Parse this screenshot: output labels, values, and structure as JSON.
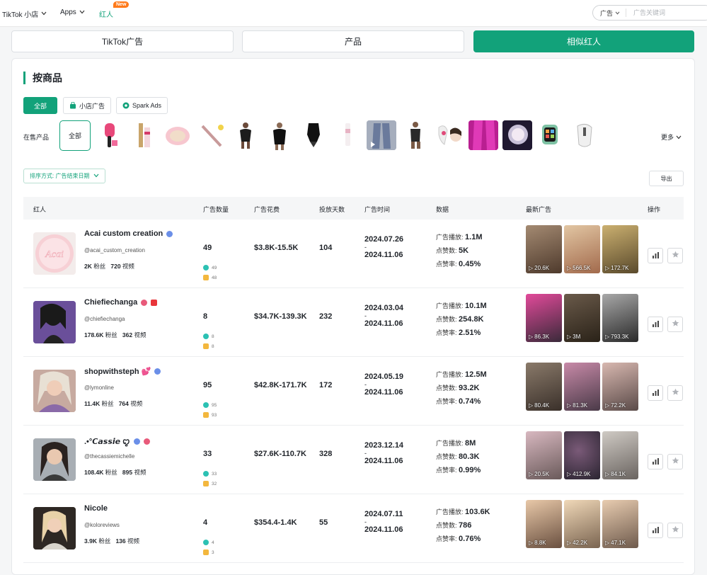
{
  "nav": {
    "items": [
      {
        "label": "TikTok 小店"
      },
      {
        "label": "Apps"
      },
      {
        "label": "红人"
      }
    ],
    "new_badge": "New",
    "search_select": "广告",
    "search_placeholder": "广告关键词"
  },
  "tabs": [
    {
      "label": "TikTok广告"
    },
    {
      "label": "产品"
    },
    {
      "label": "相似红人"
    }
  ],
  "section": {
    "title": "按商品",
    "filters": [
      {
        "label": "全部"
      },
      {
        "label": "小店广告"
      },
      {
        "label": "Spark Ads"
      }
    ],
    "products_label": "在售产品",
    "products_all": "全部",
    "more": "更多",
    "sort_label": "排序方式: 广告结束日期",
    "export": "导出"
  },
  "table": {
    "headers": [
      "红人",
      "广告数量",
      "广告花费",
      "投放天数",
      "广告时间",
      "数据",
      "最新广告",
      "操作"
    ],
    "metric_labels": [
      "广告播放:",
      "点赞数:",
      "点赞率:"
    ],
    "followers_suffix": "粉丝",
    "videos_suffix": "视频",
    "rows": [
      {
        "name": "Acai custom creation",
        "handle": "@acai_custom_creation",
        "followers": "2K",
        "videos": "720",
        "ad_count": "49",
        "sub1": "49",
        "sub2": "48",
        "spend": "$3.8K-15.5K",
        "days": "104",
        "start": "2024.07.26",
        "end": "2024.11.06",
        "plays": "1.1M",
        "likes": "5K",
        "like_rate": "0.45%",
        "videos_views": [
          "20.6K",
          "566.5K",
          "172.7K"
        ]
      },
      {
        "name": "Chiefiechanga",
        "handle": "@chiefiechanga",
        "followers": "178.6K",
        "videos": "362",
        "ad_count": "8",
        "sub1": "8",
        "sub2": "8",
        "spend": "$34.7K-139.3K",
        "days": "232",
        "start": "2024.03.04",
        "end": "2024.11.06",
        "plays": "10.1M",
        "likes": "254.8K",
        "like_rate": "2.51%",
        "videos_views": [
          "86.3K",
          "3M",
          "793.3K"
        ]
      },
      {
        "name": "shopwithsteph 💕",
        "handle": "@lymonline",
        "followers": "11.4K",
        "videos": "764",
        "ad_count": "95",
        "sub1": "95",
        "sub2": "93",
        "spend": "$42.8K-171.7K",
        "days": "172",
        "start": "2024.05.19",
        "end": "2024.11.06",
        "plays": "12.5M",
        "likes": "93.2K",
        "like_rate": "0.74%",
        "videos_views": [
          "80.4K",
          "81.3K",
          "72.2K"
        ]
      },
      {
        "name": ".•°𝘾𝙖𝙨𝙨𝙞𝙚 ꨄ",
        "handle": "@thecassiemichelle",
        "followers": "108.4K",
        "videos": "895",
        "ad_count": "33",
        "sub1": "33",
        "sub2": "32",
        "spend": "$27.6K-110.7K",
        "days": "328",
        "start": "2023.12.14",
        "end": "2024.11.06",
        "plays": "8M",
        "likes": "80.3K",
        "like_rate": "0.99%",
        "videos_views": [
          "20.5K",
          "412.9K",
          "84.1K"
        ]
      },
      {
        "name": "Nicole",
        "handle": "@koloreviews",
        "followers": "3.9K",
        "videos": "136",
        "ad_count": "4",
        "sub1": "4",
        "sub2": "3",
        "spend": "$354.4-1.4K",
        "days": "55",
        "start": "2024.07.11",
        "end": "2024.11.06",
        "plays": "103.6K",
        "likes": "786",
        "like_rate": "0.76%",
        "videos_views": [
          "8.8K",
          "42.2K",
          "47.1K"
        ]
      }
    ]
  },
  "colors": {
    "accent": "#12a27a",
    "badge": "#ff7a1a"
  }
}
